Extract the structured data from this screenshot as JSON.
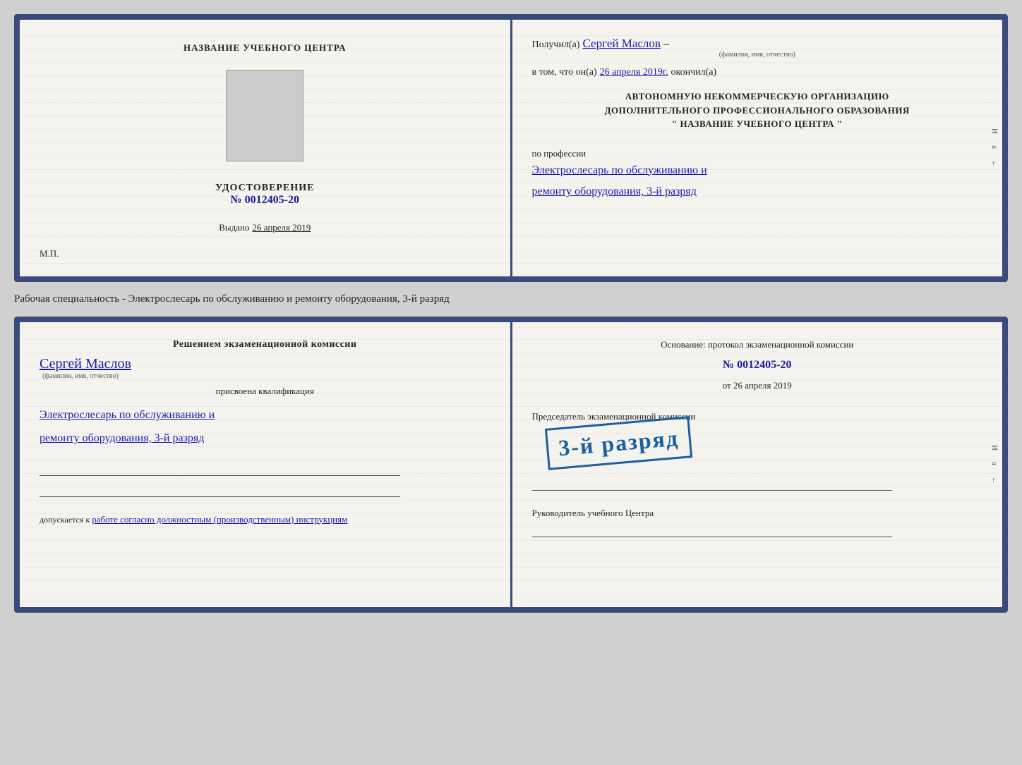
{
  "top_card": {
    "left": {
      "center_title": "НАЗВАНИЕ УЧЕБНОГО ЦЕНТРА",
      "udostoverenie_label": "УДОСТОВЕРЕНИЕ",
      "udostoverenie_number": "№ 0012405-20",
      "vydano_label": "Выдано",
      "vydano_date": "26 апреля 2019",
      "mp_label": "М.П."
    },
    "right": {
      "poluchil_label": "Получил(а)",
      "poluchil_name": "Сергей Маслов",
      "fio_label": "(фамилия, имя, отчество)",
      "vtom_label": "в том, что он(а)",
      "vtom_date": "26 апреля 2019г.",
      "okonchil_label": "окончил(а)",
      "org_line1": "АВТОНОМНУЮ НЕКОММЕРЧЕСКУЮ ОРГАНИЗАЦИЮ",
      "org_line2": "ДОПОЛНИТЕЛЬНОГО ПРОФЕССИОНАЛЬНОГО ОБРАЗОВАНИЯ",
      "org_line3": "\"  НАЗВАНИЕ УЧЕБНОГО ЦЕНТРА   \"",
      "po_professii": "по профессии",
      "profession": "Электрослесарь по обслуживанию и",
      "profession2": "ремонту оборудования, 3-й разряд"
    }
  },
  "middle_text": "Рабочая специальность - Электрослесарь по обслуживанию и ремонту оборудования, 3-й разряд",
  "bottom_card": {
    "left": {
      "resheniem_title": "Решением экзаменационной  комиссии",
      "name_handwritten": "Сергей Маслов",
      "fio_label": "(фамилия, имя, отчество)",
      "prisvoena_label": "присвоена квалификация",
      "qualification1": "Электрослесарь по обслуживанию и",
      "qualification2": "ремонту оборудования, 3-й разряд",
      "dopuskaetsya": "допускается к",
      "dopusk_text": "работе согласно должностным (производственным) инструкциям"
    },
    "right": {
      "osnovanie_title": "Основание: протокол экзаменационной  комиссии",
      "proto_number": "№  0012405-20",
      "ot_label": "от",
      "ot_date": "26 апреля 2019",
      "predsedatel_label": "Председатель экзаменационной комиссии",
      "rukovoditel_label": "Руководитель учебного Центра"
    },
    "stamp": {
      "text": "3-й разряд"
    }
  }
}
